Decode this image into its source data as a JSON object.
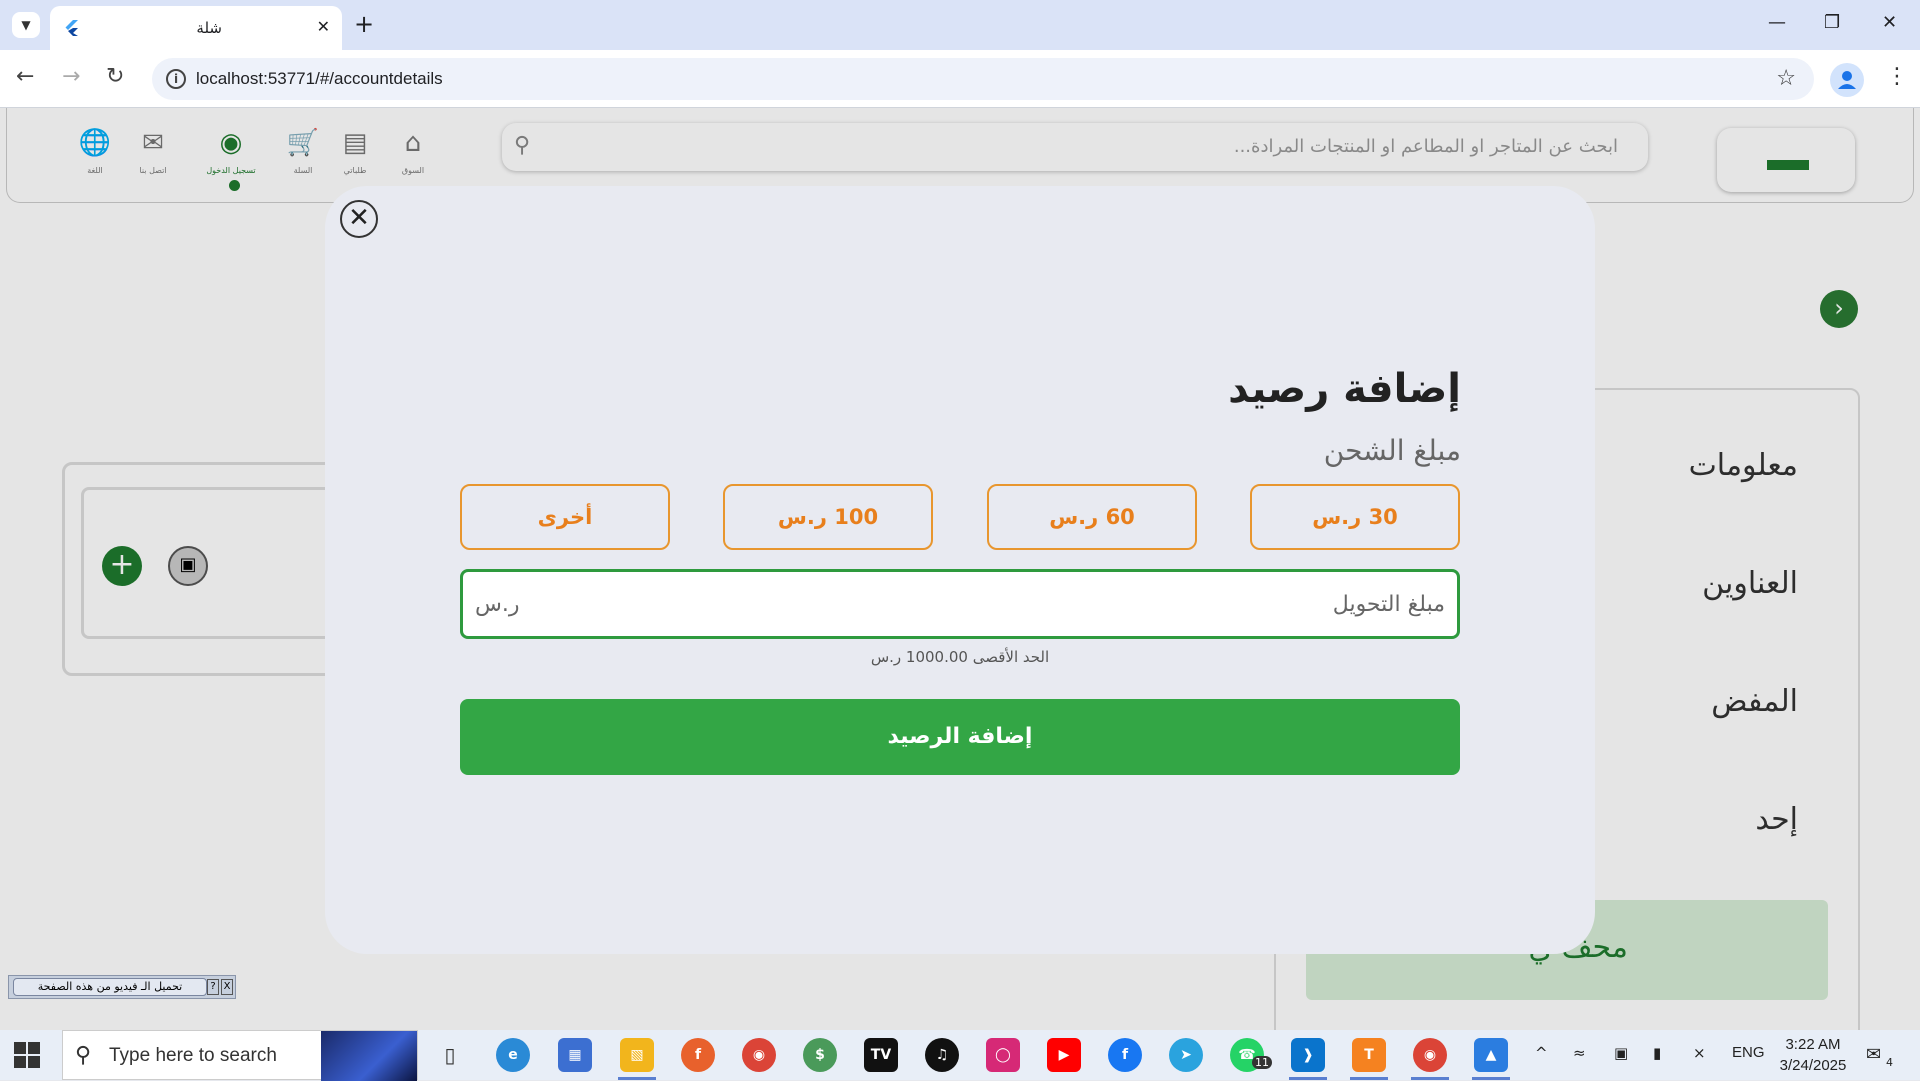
{
  "browser": {
    "tab_title": "شلة",
    "url": "localhost:53771/#/accountdetails"
  },
  "app_nav": {
    "items": [
      {
        "label": "اللغة"
      },
      {
        "label": "اتصل بنا"
      },
      {
        "label": "تسجيل الدخول"
      },
      {
        "label": "السلة"
      },
      {
        "label": "طلباتي"
      },
      {
        "label": "السوق"
      }
    ],
    "search_placeholder": "ابحث عن المتاجر او المطاعم او المنتجات المرادة..."
  },
  "side_panel": {
    "items": [
      "معلومات",
      "العناوين",
      "المفض",
      "إحد"
    ],
    "green_label": "محف ي"
  },
  "download_widget": {
    "label": "تحميل الـ فيديو من هذه الصفحة",
    "help": "?",
    "close": "X"
  },
  "modal": {
    "title": "إضافة رصيد",
    "subtitle": "مبلغ الشحن",
    "amount_options": [
      "30 ر.س",
      "60 ر.س",
      "100 ر.س",
      "أخرى"
    ],
    "input_placeholder": "مبلغ التحويل",
    "input_unit": "ر.س",
    "max_note": "الحد الأقصى 1000.00 ر.س",
    "submit_label": "إضافة الرصيد",
    "colors": {
      "accent": "#33a645",
      "option_border": "#e8962e",
      "option_text": "#e87f1c"
    }
  },
  "taskbar": {
    "search_placeholder": "Type here to search",
    "language": "ENG",
    "time": "3:22 AM",
    "date": "3/24/2025",
    "whatsapp_badge": "11",
    "notification_count": "4"
  }
}
